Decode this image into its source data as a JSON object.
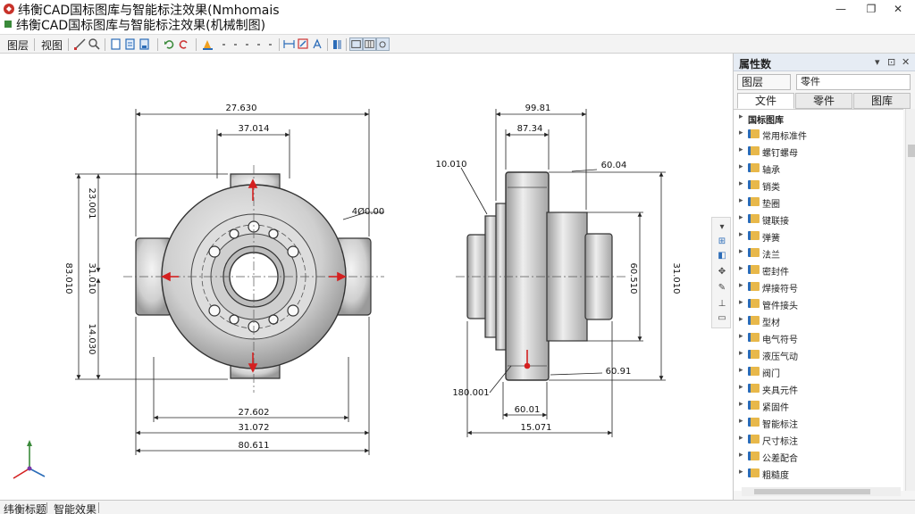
{
  "window": {
    "title": "纬衡CAD国标图库与智能标注效果(Nmhomais",
    "subtitle": "纬衡CAD国标图库与智能标注效果(机械制图)",
    "minimize_glyph": "—",
    "maximize_glyph": "❐",
    "close_glyph": "✕"
  },
  "toolbar": {
    "label_1": "图层",
    "label_2": "视图"
  },
  "drawing": {
    "front_top_width": "27.630",
    "front_inner_width": "37.014",
    "front_left_outer": "83.010",
    "front_left_upper": "23.001",
    "front_left_mid": "31.010",
    "front_left_lower": "14.030",
    "front_radius": "4Ø0.00",
    "front_bottom_1": "27.602",
    "front_bottom_2": "31.072",
    "front_bottom_3": "80.611",
    "side_top_width": "99.81",
    "side_inner_width": "87.34",
    "side_left_note": "10.010",
    "side_right_note": "60.04",
    "side_right_outer": "31.010",
    "side_right_inner": "60.510",
    "side_lower_right": "60.91",
    "side_lower_left": "180.001",
    "side_bottom_1": "60.01",
    "side_bottom_2": "15.071"
  },
  "panel": {
    "title": "属性数",
    "pin_glyph": "▾",
    "float_glyph": "⊡",
    "close_glyph": "✕",
    "combo_label": "图层",
    "combo_value": "零件",
    "tabs": [
      "文件",
      "零件",
      "图库"
    ],
    "tree_header": "国标图库",
    "tree_items": [
      "常用标准件",
      "螺钉螺母",
      "轴承",
      "销类",
      "垫圈",
      "键联接",
      "弹簧",
      "法兰",
      "密封件",
      "焊接符号",
      "管件接头",
      "型材",
      "电气符号",
      "液压气动",
      "阀门",
      "夹具元件",
      "紧固件",
      "智能标注",
      "尺寸标注",
      "公差配合",
      "粗糙度"
    ]
  },
  "colors": {
    "accent": "#2b6cb8",
    "folder": "#e8b84a",
    "arrow_red": "#d42020"
  },
  "status": {
    "item_1": "纬衡标题",
    "item_2": "智能效果"
  }
}
